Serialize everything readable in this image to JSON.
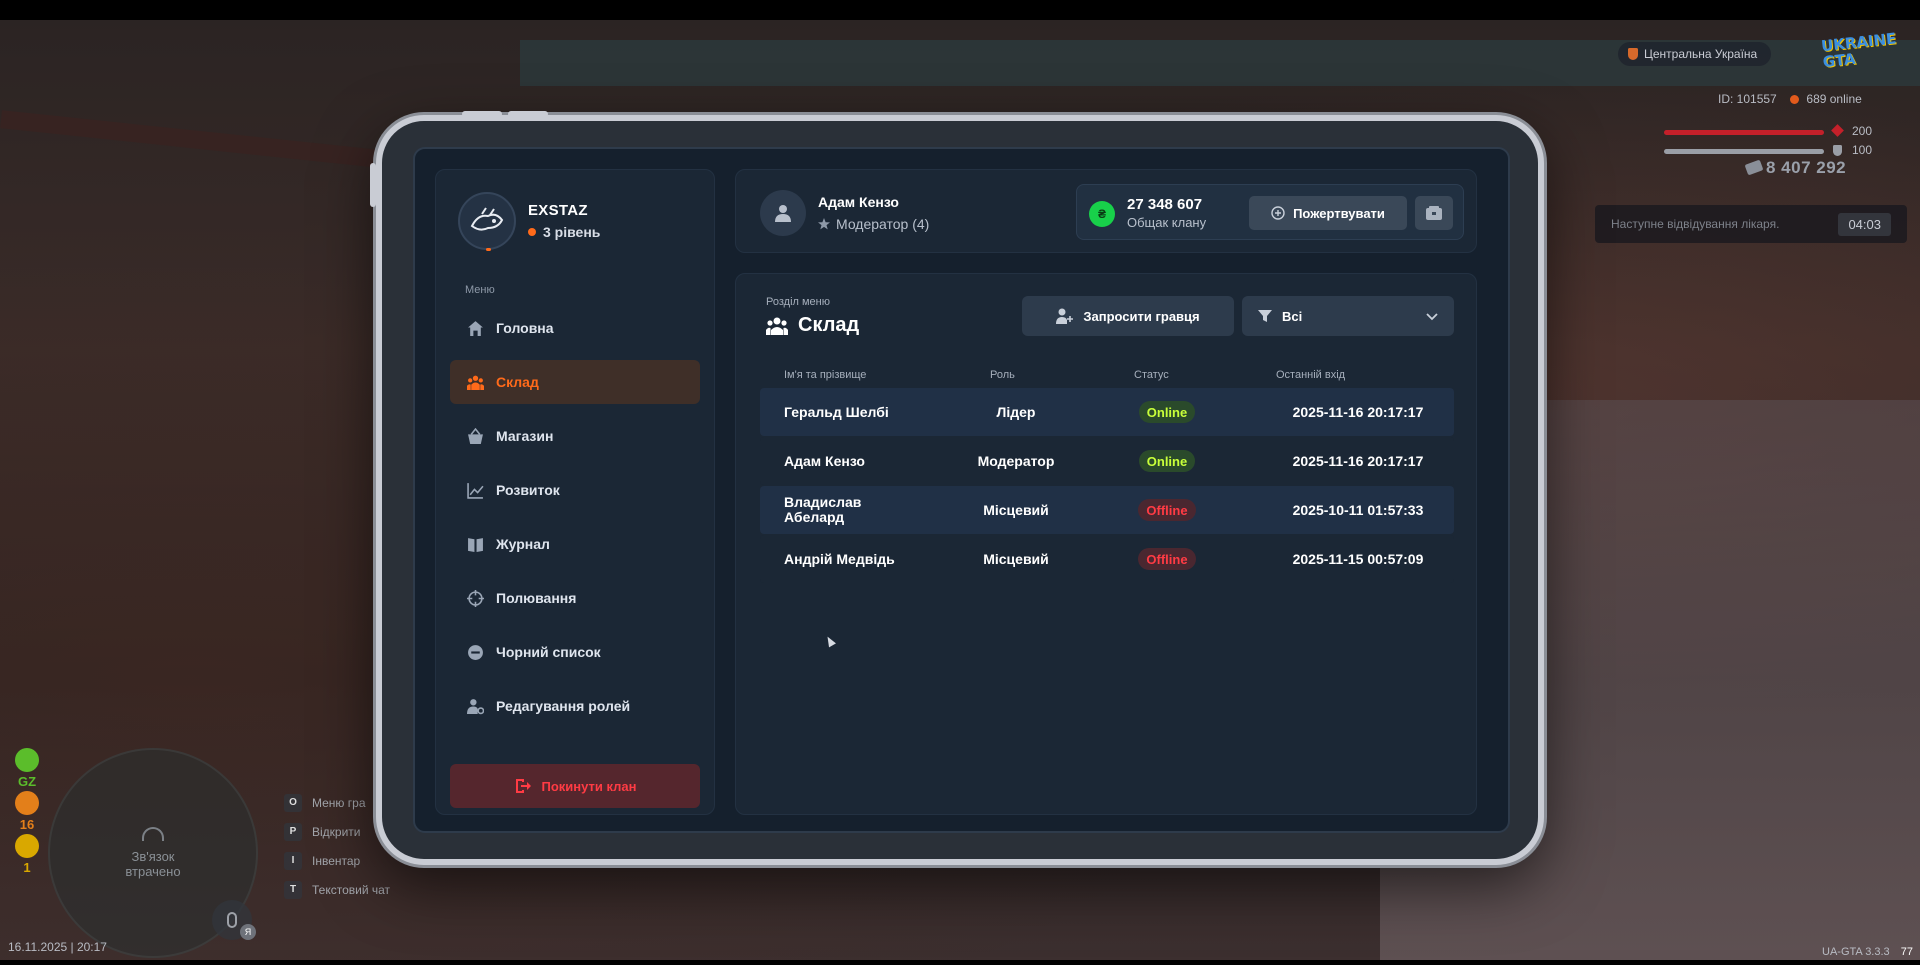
{
  "hud": {
    "region": "Центральна Україна",
    "logo_text": "UKRAINE GTA",
    "player_id": "ID: 101557",
    "online": "689 online",
    "health": "200",
    "armor": "100",
    "money": "8 407 292",
    "doctor_text": "Наступне відвідування лікаря.",
    "doctor_timer": "04:03",
    "radar_text": "Зв'язок втрачено",
    "badges": [
      {
        "label": "GZ",
        "color": "#5bbd2b"
      },
      {
        "label": "16",
        "color": "#e37f1a"
      },
      {
        "label": "1",
        "color": "#d9a800"
      }
    ],
    "keys": [
      {
        "key": "O",
        "label": "Меню гра"
      },
      {
        "key": "P",
        "label": "Відкрити"
      },
      {
        "key": "I",
        "label": "Інвентар"
      },
      {
        "key": "T",
        "label": "Текстовий чат"
      }
    ],
    "mic_lang": "Я",
    "datetime": "16.11.2025 | 20:17",
    "version": "UA-GTA 3.3.3",
    "version_suffix": "77"
  },
  "sidebar": {
    "clan_name": "EXSTAZ",
    "clan_level": "3 рівень",
    "menu_caption": "Меню",
    "items": [
      {
        "label": "Головна",
        "icon": "home-icon"
      },
      {
        "label": "Склад",
        "icon": "group-icon"
      },
      {
        "label": "Магазин",
        "icon": "basket-icon"
      },
      {
        "label": "Розвиток",
        "icon": "chart-icon"
      },
      {
        "label": "Журнал",
        "icon": "book-icon"
      },
      {
        "label": "Полювання",
        "icon": "crosshair-icon"
      },
      {
        "label": "Чорний список",
        "icon": "minus-circle-icon"
      },
      {
        "label": "Редагування ролей",
        "icon": "user-gear-icon"
      }
    ],
    "active_index": 1,
    "leave_label": "Покинути клан"
  },
  "topbar": {
    "user_name": "Адам Кензо",
    "user_role": "Модератор (4)",
    "balance_amount": "27 348 607",
    "balance_label": "Общак клану",
    "coin_symbol": "₴",
    "donate_label": "Пожертвувати"
  },
  "content": {
    "section_caption": "Розділ меню",
    "section_title": "Склад",
    "invite_label": "Запросити гравця",
    "filter_value": "Всі",
    "columns": {
      "name": "Ім'я та прізвище",
      "role": "Роль",
      "status": "Статус",
      "last": "Останній вхід"
    },
    "rows": [
      {
        "name": "Геральд Шелбі",
        "role": "Лідер",
        "status": "Online",
        "last": "2025-11-16 20:17:17"
      },
      {
        "name": "Адам Кензо",
        "role": "Модератор",
        "status": "Online",
        "last": "2025-11-16 20:17:17"
      },
      {
        "name": "Владислав Абелард",
        "role": "Місцевий",
        "status": "Offline",
        "last": "2025-10-11 01:57:33"
      },
      {
        "name": "Андрій Медвідь",
        "role": "Місцевий",
        "status": "Offline",
        "last": "2025-11-15 00:57:09"
      }
    ]
  },
  "colors": {
    "accent": "#ff6a1a",
    "online": "#c8ff3a",
    "offline": "#ff3b44",
    "panel": "#1b2735"
  }
}
